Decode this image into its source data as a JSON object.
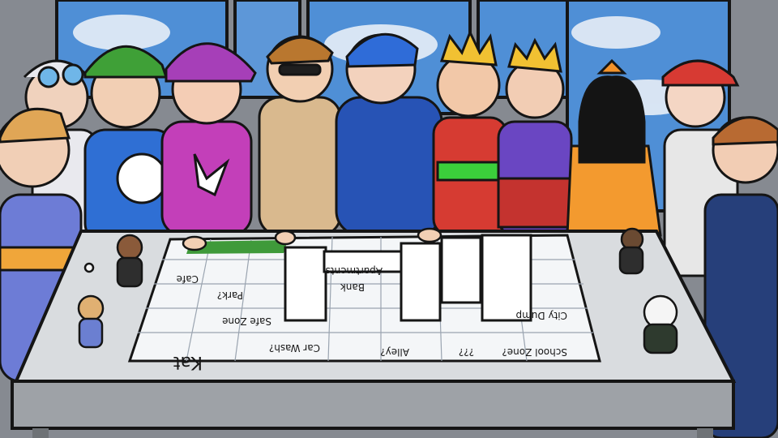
{
  "scene": {
    "palette": {
      "window_sky": "#4f8fd6",
      "window_frame": "#7d8188",
      "table_top": "#d9dcdf",
      "table_side": "#9ea2a7",
      "outline": "#151515",
      "map_paper": "#f4f6f8",
      "map_green_patch": "#3f9a3a"
    }
  },
  "map": {
    "labels": [
      {
        "text": "Cafe"
      },
      {
        "text": "Park?"
      },
      {
        "text": "Safe Zone"
      },
      {
        "text": "Car Wash?"
      },
      {
        "text": "Bank"
      },
      {
        "text": "Apartments"
      },
      {
        "text": "Alley?"
      },
      {
        "text": "???"
      },
      {
        "text": "City Dump"
      },
      {
        "text": "School Zone?"
      },
      {
        "text": "Kat"
      }
    ]
  },
  "characters": [
    {
      "icon": "goggles-kid"
    },
    {
      "icon": "green-cap-kid"
    },
    {
      "icon": "purple-cap-kid"
    },
    {
      "icon": "tan-hoodie-kid"
    },
    {
      "icon": "blue-hoodie-kid"
    },
    {
      "icon": "crown-kid-red"
    },
    {
      "icon": "crown-kid-purple"
    },
    {
      "icon": "orange-dress-girl"
    },
    {
      "icon": "red-cap-kid"
    },
    {
      "icon": "blonde-kid"
    },
    {
      "icon": "glasses-kid"
    }
  ]
}
